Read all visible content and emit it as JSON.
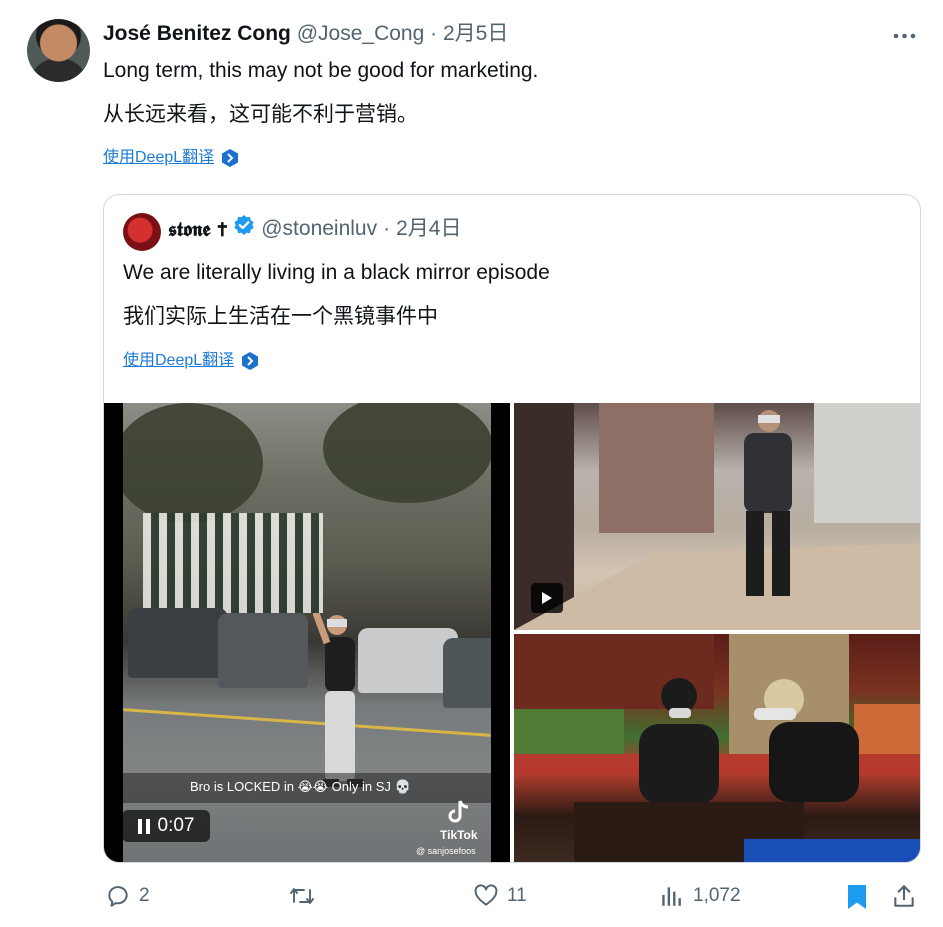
{
  "tweet": {
    "author_name": "José Benitez Cong",
    "author_handle": "@Jose_Cong",
    "separator": "·",
    "date": "2月5日",
    "text_en": "Long term, this may not be good for marketing.",
    "text_zh": "从长远来看，这可能不利于营销。",
    "translate_label": "使用DeepL翻译",
    "more_icon": "more-horizontal-icon"
  },
  "quoted": {
    "author_name": "𝖘𝖙𝖔𝖓𝖊 ✝",
    "verified_icon": "verified-badge-icon",
    "author_handle": "@stoneinluv",
    "separator": "·",
    "date": "2月4日",
    "text_en": "We are literally living in a black mirror episode",
    "text_zh": "我们实际上生活在一个黑镜事件中",
    "translate_label": "使用DeepL翻译",
    "media": {
      "video_caption": "Bro is LOCKED in 😭😭 Only in SJ 💀",
      "video_time": "0:07",
      "tiktok_label": "TikTok",
      "tiktok_user": "@ sanjosefoos"
    }
  },
  "actions": {
    "replies": "2",
    "retweets": "",
    "likes": "11",
    "views": "1,072"
  },
  "colors": {
    "link": "#1d7bd8",
    "muted": "#536471",
    "bookmark": "#1d9bf0",
    "verified": "#1d9bf0"
  }
}
